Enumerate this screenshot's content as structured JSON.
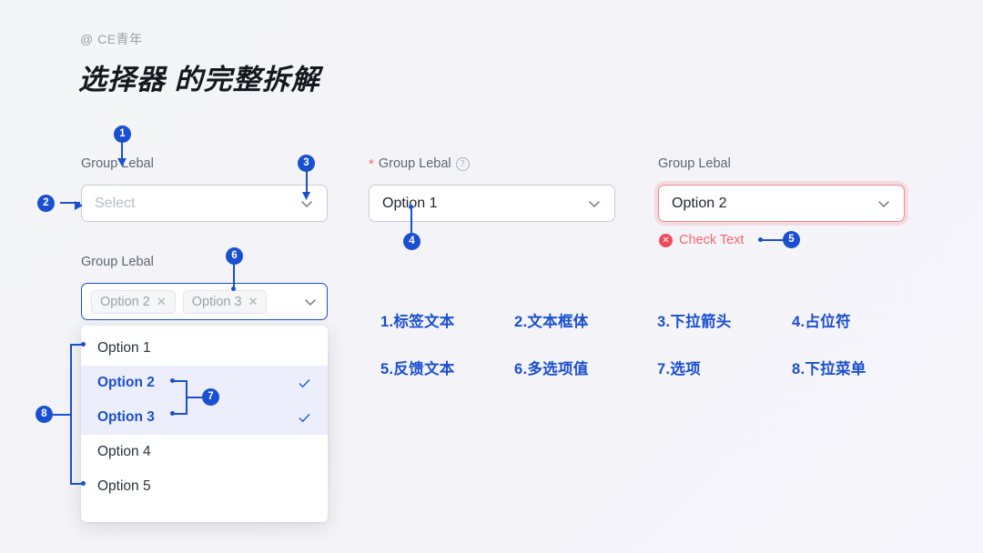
{
  "header": {
    "handle": "@ CE青年",
    "title": "选择器 的完整拆解"
  },
  "colors": {
    "accent_blue": "#1a4fd0",
    "error_red": "#f5666e",
    "background": "#f4f5f7",
    "selected_row_bg": "#edeefb",
    "text_dark": "#22262e",
    "label_gray": "#5d6470",
    "placeholder_gray": "#b8bdc5"
  },
  "fields": {
    "basic": {
      "label": "Group Lebal",
      "placeholder": "Select",
      "value": "",
      "chevron_icon": "chevron-down-icon"
    },
    "required": {
      "label": "Group Lebal",
      "required_marker": "*",
      "help_icon": "help-circle-icon",
      "help_glyph": "?",
      "value": "Option 1",
      "chevron_icon": "chevron-down-icon"
    },
    "error": {
      "label": "Group Lebal",
      "value": "Option 2",
      "error_icon": "error-circle-icon",
      "error_glyph": "✕",
      "error_text": "Check Text",
      "chevron_icon": "chevron-down-icon"
    },
    "multi": {
      "label": "Group Lebal",
      "chevron_icon": "chevron-down-icon",
      "tags": [
        {
          "label": "Option 2",
          "close_icon": "close-icon",
          "close_glyph": "✕"
        },
        {
          "label": "Option 3",
          "close_icon": "close-icon",
          "close_glyph": "✕"
        }
      ]
    }
  },
  "dropdown": {
    "items": [
      {
        "label": "Option 1",
        "selected": false
      },
      {
        "label": "Option 2",
        "selected": true
      },
      {
        "label": "Option 3",
        "selected": true
      },
      {
        "label": "Option 4",
        "selected": false
      },
      {
        "label": "Option 5",
        "selected": false
      }
    ],
    "check_icon": "check-icon"
  },
  "legend": [
    {
      "num": "1",
      "text": "1.标签文本"
    },
    {
      "num": "2",
      "text": "2.文本框体"
    },
    {
      "num": "3",
      "text": "3.下拉箭头"
    },
    {
      "num": "4",
      "text": "4.占位符"
    },
    {
      "num": "5",
      "text": "5.反馈文本"
    },
    {
      "num": "6",
      "text": "6.多选项值"
    },
    {
      "num": "7",
      "text": "7.选项"
    },
    {
      "num": "8",
      "text": "8.下拉菜单"
    }
  ],
  "callouts": [
    {
      "num": "1"
    },
    {
      "num": "2"
    },
    {
      "num": "3"
    },
    {
      "num": "4"
    },
    {
      "num": "5"
    },
    {
      "num": "6"
    },
    {
      "num": "7"
    },
    {
      "num": "8"
    }
  ]
}
